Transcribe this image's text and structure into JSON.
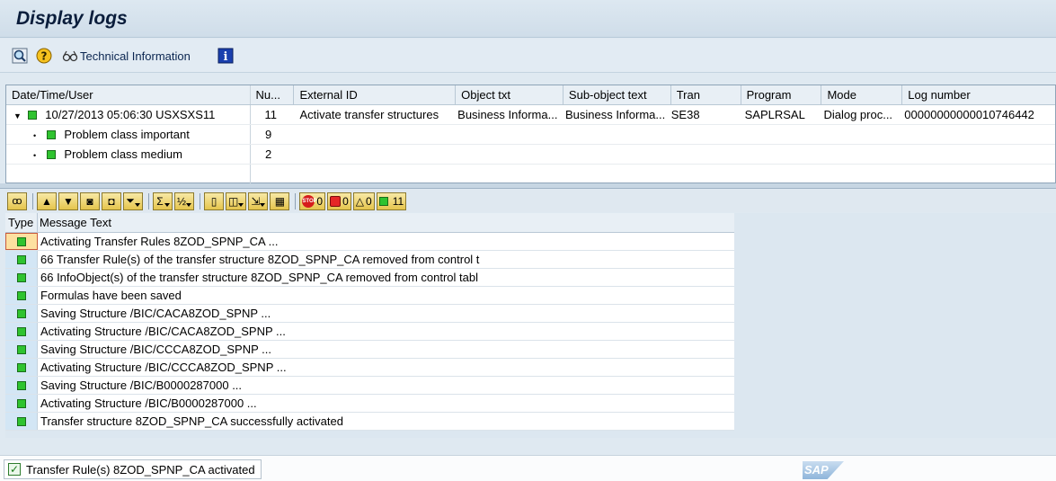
{
  "window": {
    "title": "Display logs"
  },
  "app_toolbar": {
    "technical_information_label": "Technical Information"
  },
  "log_table": {
    "columns": [
      "Date/Time/User",
      "Nu...",
      "External ID",
      "Object txt",
      "Sub-object text",
      "Tran",
      "Program",
      "Mode",
      "Log number"
    ],
    "main_row": {
      "datetime_user": "10/27/2013  05:06:30  USXSXS11",
      "number": "11",
      "external_id": "Activate transfer structures",
      "object_txt": "Business Informa...",
      "sub_object_text": "Business Informa...",
      "tran": "SE38",
      "program": "SAPLRSAL",
      "mode": "Dialog proc...",
      "log_number": "00000000000010746442"
    },
    "child_rows": [
      {
        "label": "Problem class important",
        "count": "9"
      },
      {
        "label": "Problem class medium",
        "count": "2"
      }
    ]
  },
  "message_toolbar": {
    "stop_count": "0",
    "error_count": "0",
    "warning_count": "0",
    "success_count": "11"
  },
  "messages": {
    "headers": {
      "type": "Type",
      "text": "Message Text"
    },
    "rows": [
      "Activating Transfer Rules 8ZOD_SPNP_CA ...",
      "66 Transfer Rule(s) of the transfer structure 8ZOD_SPNP_CA removed from control t",
      "66 InfoObject(s) of the transfer structure 8ZOD_SPNP_CA removed from control tabl",
      "Formulas have been saved",
      "Saving Structure /BIC/CACA8ZOD_SPNP ...",
      "Activating Structure /BIC/CACA8ZOD_SPNP ...",
      "Saving Structure /BIC/CCCA8ZOD_SPNP ...",
      "Activating Structure /BIC/CCCA8ZOD_SPNP ...",
      "Saving Structure /BIC/B0000287000 ...",
      "Activating Structure /BIC/B0000287000 ...",
      "Transfer structure 8ZOD_SPNP_CA successfully activated"
    ]
  },
  "status_bar": {
    "message": "Transfer Rule(s) 8ZOD_SPNP_CA activated",
    "logo_text": "SAP"
  },
  "colors": {
    "success_green": "#2fc32f",
    "title_text": "#0a1d3b",
    "toolbar_button": "#e5c54d"
  }
}
